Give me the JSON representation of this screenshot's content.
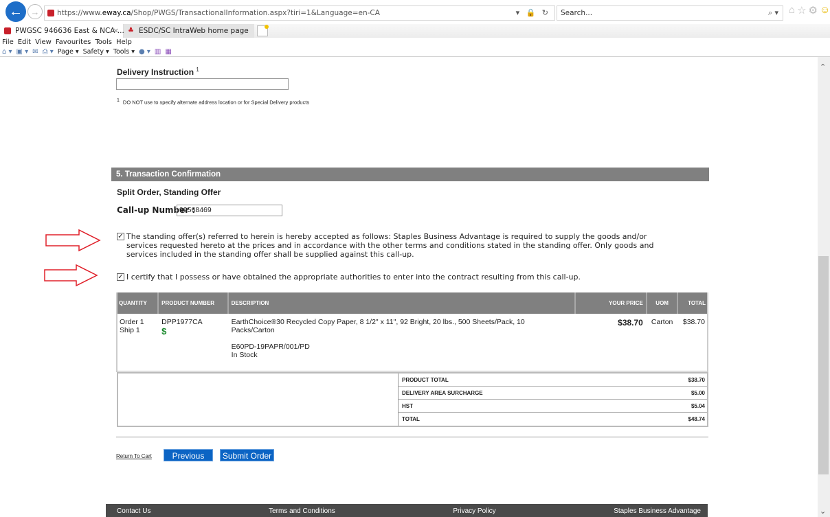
{
  "browser": {
    "url_prefix": "https://www.",
    "url_host": "eway.ca",
    "url_path": "/Shop/PWGS/TransactionalInformation.aspx?tiri=1&Language=en-CA",
    "url_actions": "▾ 🔒 ↻",
    "search_placeholder": "Search...",
    "search_icon": "⌕ ▾",
    "back_icon": "←",
    "forward_icon": "→",
    "tabs": [
      {
        "label": "PWGSC 946636 East & NCA ...",
        "close": "×",
        "favicon_color": "#c8202a"
      },
      {
        "label": "ESDC/SC IntraWeb home page",
        "favicon_color": "#c8202a"
      }
    ],
    "menu": [
      "File",
      "Edit",
      "View",
      "Favourites",
      "Tools",
      "Help"
    ],
    "commands": [
      "Page ▾",
      "Safety ▾",
      "Tools ▾"
    ],
    "tool_icons": {
      "home": "⌂",
      "favorites": "☆",
      "settings": "⚙",
      "feedback": "☺"
    }
  },
  "form": {
    "delivery_instruction_label": "Delivery Instruction",
    "delivery_instruction_sup": "1",
    "delivery_instruction_value": "",
    "footnote_marker": "1",
    "footnote_text": "DO NOT use to specify alternate address location or for Special Delivery products"
  },
  "confirmation": {
    "section_title": "5. Transaction Confirmation",
    "order_type": "Split Order, Standing Offer",
    "callup_label": "Call-up Number :",
    "callup_value": "99568469",
    "check1_checked": true,
    "check1_text": "The standing offer(s) referred to herein is hereby accepted as follows: Staples Business Advantage is required to supply the goods and/or services requested hereto at the prices and in accordance with the other terms and conditions stated in the standing offer. Only goods and services included in the standing offer shall be supplied against this call-up.",
    "check2_checked": true,
    "check2_text": "I certify that I possess or have obtained the appropriate authorities to enter into the contract resulting from this call-up.",
    "check_glyph": "✓"
  },
  "annotation_color": "#e0202a",
  "order_table": {
    "headers": [
      "QUANTITY",
      "PRODUCT NUMBER",
      "DESCRIPTION",
      "YOUR PRICE",
      "UOM",
      "TOTAL"
    ],
    "rows": [
      {
        "quantity_line1": "Order 1",
        "quantity_line2": "Ship 1",
        "product_number": "DPP1977CA",
        "price_icon": "$",
        "description": "EarthChoice®30 Recycled Copy Paper, 8 1/2\" x 11\", 92 Bright, 20 lbs., 500 Sheets/Pack, 10 Packs/Carton",
        "sku": "E60PD-19PAPR/001/PD",
        "stock": "In Stock",
        "your_price": "$38.70",
        "uom": "Carton",
        "total": "$38.70"
      }
    ]
  },
  "totals": [
    {
      "label": "PRODUCT TOTAL",
      "value": "$38.70"
    },
    {
      "label": "DELIVERY AREA SURCHARGE",
      "value": "$5.00"
    },
    {
      "label": "HST",
      "value": "$5.04"
    },
    {
      "label": "TOTAL",
      "value": "$48.74"
    }
  ],
  "actions": {
    "return_label": "Return To Cart",
    "previous_label": "Previous",
    "submit_label": "Submit Order",
    "button_color": "#0b64c4"
  },
  "footer": [
    "Contact Us",
    "Terms and Conditions",
    "Privacy Policy",
    "Staples Business Advantage"
  ],
  "scrollbar": {
    "up": "⌃",
    "down": "⌄",
    "position_fraction": 0.55
  }
}
